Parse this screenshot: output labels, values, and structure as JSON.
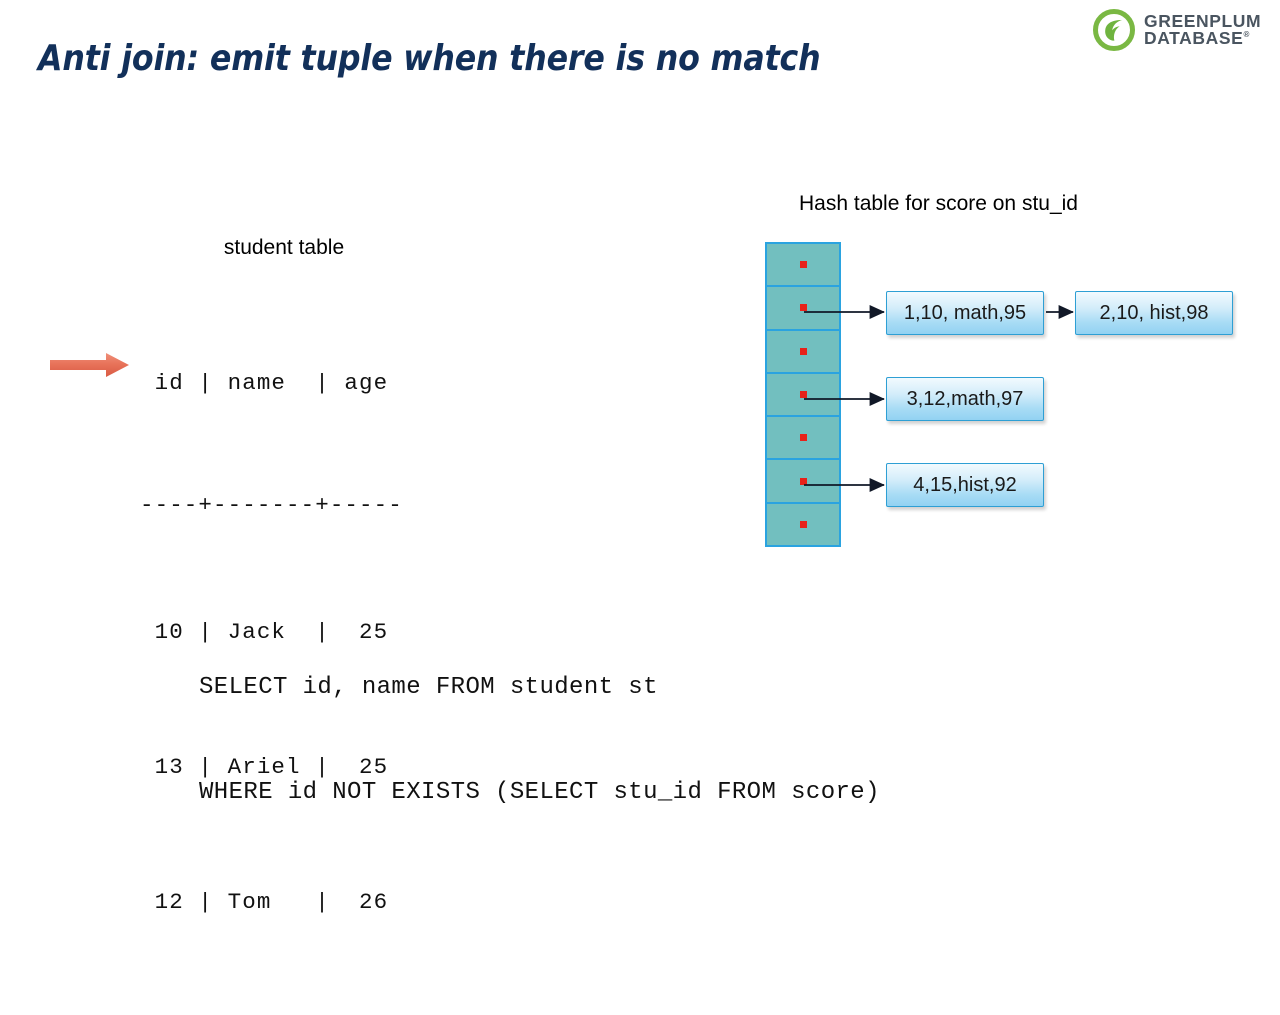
{
  "slide": {
    "title": "Anti join: emit tuple when there is no match",
    "title_color": "#12305A",
    "background": "#FFFFFF"
  },
  "logo": {
    "mark_name": "greenplum-leaf-icon",
    "mark_color": "#7AB843",
    "line1": "GREENPLUM",
    "line2": "DATABASE",
    "registered_mark": "®",
    "text_color": "#4A5560"
  },
  "student_table": {
    "caption": "student table",
    "header": " id | name  | age",
    "separator": "----+-------+-----",
    "rows": [
      " 10 | Jack  |  25",
      " 13 | Ariel |  25",
      " 12 | Tom   |  26"
    ],
    "pointer": {
      "name": "current-row-arrow",
      "points_to_row": " 10 | Jack  |  25",
      "color": "#E8735A"
    }
  },
  "hash_table": {
    "caption": "Hash table for score on stu_id",
    "bucket_count": 7,
    "bucket_color": "#72BFBF",
    "bucket_border_color": "#2AA3E0",
    "pointer_dot_color": "#E8221A",
    "buckets": [
      {
        "index": 0,
        "has_chain": false
      },
      {
        "index": 1,
        "has_chain": true
      },
      {
        "index": 2,
        "has_chain": false
      },
      {
        "index": 3,
        "has_chain": true
      },
      {
        "index": 4,
        "has_chain": false
      },
      {
        "index": 5,
        "has_chain": true
      },
      {
        "index": 6,
        "has_chain": false
      }
    ],
    "entries": [
      {
        "id": "entry-0",
        "label": "1,10, math,95",
        "bucket": 1,
        "chain_position": 0
      },
      {
        "id": "entry-1",
        "label": "2,10, hist,98",
        "bucket": 1,
        "chain_position": 1
      },
      {
        "id": "entry-2",
        "label": "3,12,math,97",
        "bucket": 3,
        "chain_position": 0
      },
      {
        "id": "entry-3",
        "label": "4,15,hist,92",
        "bucket": 5,
        "chain_position": 0
      }
    ],
    "entry_box_color": "#A9DCF5",
    "entry_border_color": "#2E9FD4"
  },
  "sql": {
    "line1": "SELECT id, name FROM student st",
    "line2": "WHERE id NOT EXISTS (SELECT stu_id FROM score)"
  }
}
